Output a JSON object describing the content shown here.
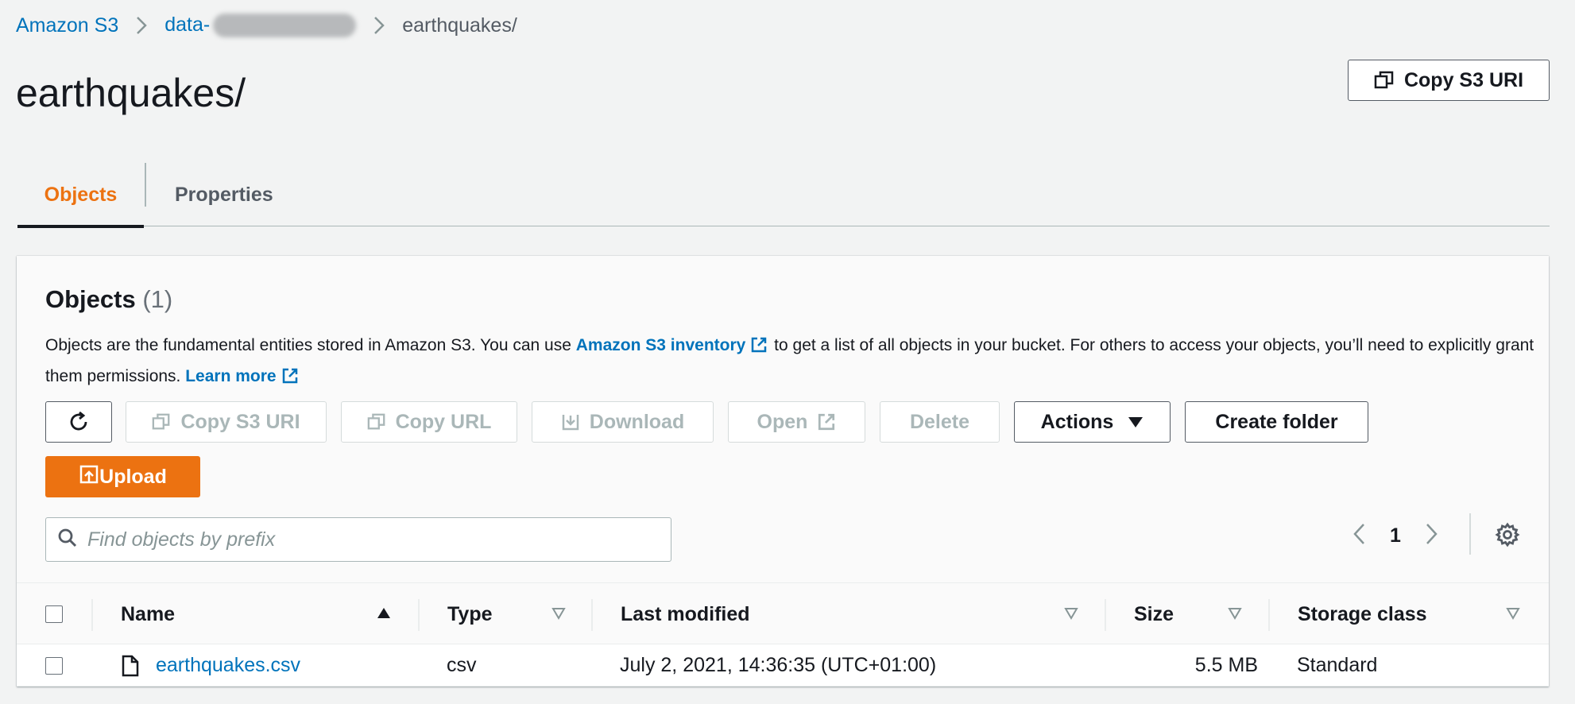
{
  "breadcrumb": {
    "root": "Amazon S3",
    "bucket": "data-",
    "current": "earthquakes/"
  },
  "page": {
    "title": "earthquakes/",
    "copy_uri_label": "Copy S3 URI"
  },
  "tabs": {
    "objects": "Objects",
    "properties": "Properties"
  },
  "objects_panel": {
    "title": "Objects",
    "count": "(1)",
    "desc_part1": "Objects are the fundamental entities stored in Amazon S3. You can use ",
    "inventory_link": "Amazon S3 inventory",
    "desc_part2": " to get a list of all objects in your bucket. For others to access your objects, you’ll need to explicitly grant them permissions. ",
    "learn_more": "Learn more"
  },
  "toolbar": {
    "copy_s3_uri": "Copy S3 URI",
    "copy_url": "Copy URL",
    "download": "Download",
    "open": "Open",
    "delete": "Delete",
    "actions": "Actions",
    "create_folder": "Create folder",
    "upload": "Upload"
  },
  "search": {
    "placeholder": "Find objects by prefix"
  },
  "pagination": {
    "current_page": "1"
  },
  "table": {
    "columns": [
      "Name",
      "Type",
      "Last modified",
      "Size",
      "Storage class"
    ],
    "rows": [
      {
        "name": "earthquakes.csv",
        "type": "csv",
        "last_modified": "July 2, 2021, 14:36:35 (UTC+01:00)",
        "size": "5.5 MB",
        "storage_class": "Standard"
      }
    ]
  },
  "colors": {
    "accent_orange": "#ec7211",
    "link_blue": "#0073bb",
    "text_dark": "#16191f",
    "disabled": "#aab7b8"
  }
}
